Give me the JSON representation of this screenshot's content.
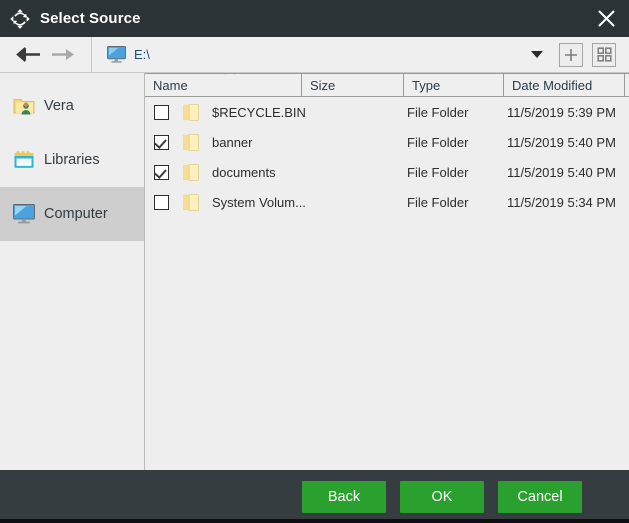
{
  "window": {
    "title": "Select Source",
    "title_icon": "move-arrows-icon",
    "close_icon": "close-icon",
    "titlebar_color": "#2b3337",
    "footer_color": "#353d40",
    "accent_color": "#2aa12e"
  },
  "toolbar": {
    "back_icon": "arrow-left-icon",
    "forward_icon": "arrow-right-icon",
    "path_icon": "computer-monitor-icon",
    "path_value": "E:\\",
    "path_placeholder": "E:\\",
    "dropdown_icon": "chevron-down-icon",
    "new_folder_icon": "plus-icon",
    "view_grid_icon": "grid-view-icon"
  },
  "sidebar": {
    "items": [
      {
        "label": "Vera",
        "icon": "user-folder-icon",
        "selected": false
      },
      {
        "label": "Libraries",
        "icon": "libraries-icon",
        "selected": false
      },
      {
        "label": "Computer",
        "icon": "computer-monitor-icon",
        "selected": true
      }
    ]
  },
  "file_list": {
    "columns": [
      {
        "label": "Name",
        "sort": "ascending"
      },
      {
        "label": "Size",
        "sort": ""
      },
      {
        "label": "Type",
        "sort": ""
      },
      {
        "label": "Date Modified",
        "sort": ""
      }
    ],
    "rows": [
      {
        "checked": false,
        "icon": "folder-icon",
        "name": "$RECYCLE.BIN",
        "size": "",
        "type": "File Folder",
        "date": "11/5/2019 5:39 PM"
      },
      {
        "checked": true,
        "icon": "folder-icon",
        "name": "banner",
        "size": "",
        "type": "File Folder",
        "date": "11/5/2019 5:40 PM"
      },
      {
        "checked": true,
        "icon": "folder-icon",
        "name": "documents",
        "size": "",
        "type": "File Folder",
        "date": "11/5/2019 5:40 PM"
      },
      {
        "checked": false,
        "icon": "folder-icon",
        "name": "System Volum...",
        "size": "",
        "type": "File Folder",
        "date": "11/5/2019 5:34 PM"
      }
    ]
  },
  "footer": {
    "back_label": "Back",
    "ok_label": "OK",
    "cancel_label": "Cancel"
  }
}
